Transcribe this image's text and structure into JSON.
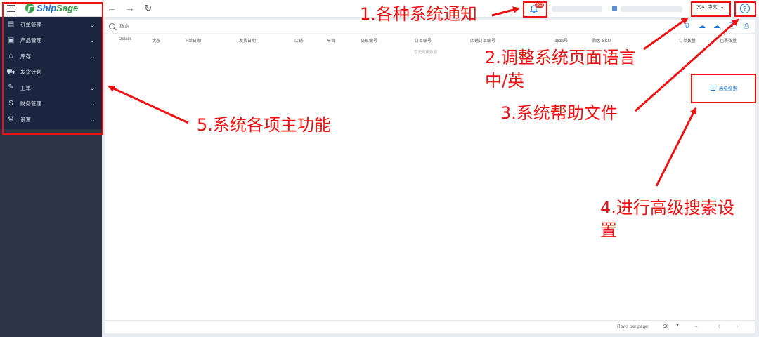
{
  "app": {
    "logo_text_a": "Ship",
    "logo_text_b": "Sage"
  },
  "sidebar": {
    "items": [
      {
        "label": "订单管理",
        "icon": "document-icon",
        "glyph": "▤",
        "expandable": true
      },
      {
        "label": "产品管理",
        "icon": "box-icon",
        "glyph": "▣",
        "expandable": true
      },
      {
        "label": "库存",
        "icon": "warehouse-icon",
        "glyph": "⌂",
        "expandable": true
      },
      {
        "label": "发货计划",
        "icon": "truck-icon",
        "glyph": "⛟",
        "expandable": false
      },
      {
        "label": "工单",
        "icon": "ticket-icon",
        "glyph": "✎",
        "expandable": true
      },
      {
        "label": "财务管理",
        "icon": "dollar-icon",
        "glyph": "$",
        "expandable": true
      },
      {
        "label": "设置",
        "icon": "gear-icon",
        "glyph": "⚙",
        "expandable": true
      }
    ]
  },
  "topbar": {
    "notification_count": "163",
    "language": "中文"
  },
  "search": {
    "placeholder": "搜索"
  },
  "table": {
    "columns": [
      "Details",
      "状态",
      "下单日期",
      "发货日期",
      "店铺",
      "平台",
      "交易编号",
      "订单编号",
      "店铺订单编号",
      "跟踪号",
      "顾客 SKU",
      "订单数量",
      "包裹数量"
    ],
    "empty_text": "暂无可用数据"
  },
  "advanced_search": {
    "label": "高级搜索"
  },
  "pagination": {
    "rows_per_page_label": "Rows per page:",
    "rows_per_page_value": "50",
    "range_text": "–"
  },
  "annotations": {
    "a1": "1.各种系统通知",
    "a2_line1": "2.调整系统页面语言",
    "a2_line2": "中/英",
    "a3": "3.系统帮助文件",
    "a4_line1": "4.进行高级搜索设",
    "a4_line2": "置",
    "a5": "5.系统各项主功能"
  },
  "colors": {
    "annotation": "#ee1111",
    "sidebar": "#1a2640",
    "accent": "#1976d2"
  }
}
